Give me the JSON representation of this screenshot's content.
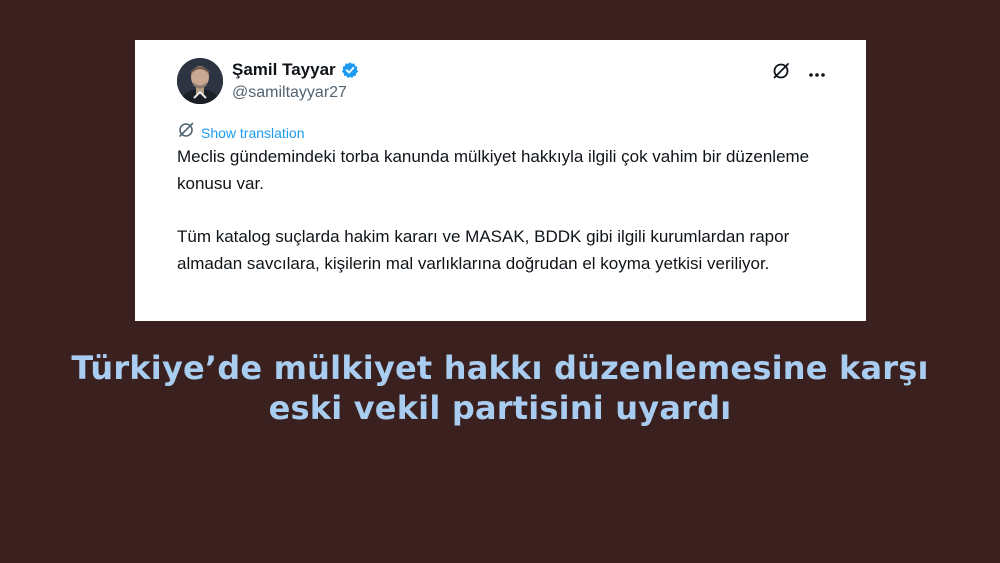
{
  "tweet": {
    "author_name": "Şamil Tayyar",
    "handle": "@samiltayyar27",
    "translate_label": "Show translation",
    "paragraphs": [
      "Meclis gündemindeki torba kanunda mülkiyet hakkıyla ilgili çok vahim bir düzenleme konusu var.",
      "Tüm katalog suçlarda hakim kararı ve MASAK, BDDK gibi ilgili kurumlardan rapor almadan savcılara, kişilerin mal varlıklarına doğrudan el koyma yetkisi veriliyor."
    ],
    "icons": {
      "verified": "verified-badge-icon",
      "grok": "grok-icon",
      "more": "more-icon",
      "translate": "translate-icon"
    }
  },
  "headline": {
    "line1": "Türkiye’de mülkiyet hakkı düzenlemesine karşı",
    "line2": "eski vekil partisini uyardı"
  },
  "colors": {
    "background": "#3a201e",
    "headline": "#a9cdf0",
    "link": "#1d9bf0",
    "verified": "#1d9bf0"
  }
}
